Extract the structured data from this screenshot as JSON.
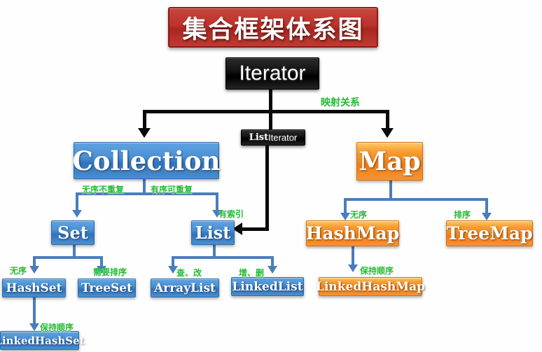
{
  "diagram": {
    "title": "集合框架体系图",
    "nodes": {
      "iterator": "Iterator",
      "listiterator_bold": "List",
      "listiterator_rest": "Iterator",
      "collection": "Collection",
      "map": "Map",
      "set": "Set",
      "list": "List",
      "hashmap": "HashMap",
      "treemap": "TreeMap",
      "hashset": "HashSet",
      "treeset": "TreeSet",
      "arraylist": "ArrayList",
      "linkedlist": "LinkedList",
      "linkedhashmap": "LinkedHashMap",
      "linkedhashset": "LinkedHashSet"
    },
    "edge_labels": {
      "iterator_to_map": "映射关系",
      "collection_to_set": "无序不重复",
      "collection_to_list": "有序可重复",
      "listiterator_to_list": "有索引",
      "set_to_hashset": "无序",
      "set_to_treeset": "需要排序",
      "list_to_arraylist": "查、改",
      "list_to_linkedlist": "增、删",
      "hashset_to_linkedhashset": "保持顺序",
      "map_to_hashmap": "无序",
      "map_to_treemap": "排序",
      "hashmap_to_linkedhashmap": "保持顺序"
    },
    "colors": {
      "title_red": "#bb332c",
      "interface_black": "#141414",
      "collection_blue": "#4a90d4",
      "map_orange": "#f79f33",
      "edge_label_green": "#22bb33",
      "blue_connector": "#4a7ebb",
      "black_connector": "#0a0a0a"
    }
  }
}
